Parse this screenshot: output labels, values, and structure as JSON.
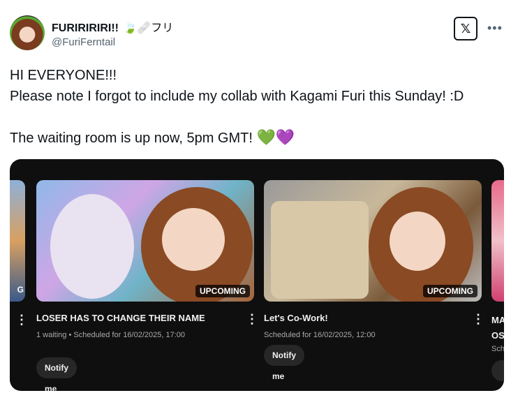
{
  "author": {
    "display_name": "FURIRIRIRI!!",
    "name_emoji": "🍃🩹フリ",
    "handle": "@FuriFerntail",
    "x_logo": "x-logo-icon",
    "more_icon": "more-icon"
  },
  "tweet": {
    "line1": "HI EVERYONE!!!",
    "line2": "Please note I forgot to include my collab with Kagami Furi this Sunday! :D",
    "line3": "The waiting room is up now, 5pm GMT!",
    "heart1": "💚",
    "heart2": "💜"
  },
  "videos": [
    {
      "badge": "UPCOMING",
      "title": "LOSER HAS TO CHANGE THEIR NAME",
      "meta": "1 waiting • Scheduled for 16/02/2025, 17:00",
      "button": "Notify me"
    },
    {
      "badge": "UPCOMING",
      "title": "Let's Co-Work!",
      "meta": "Scheduled for 16/02/2025, 12:00",
      "button": "Notify me"
    }
  ],
  "partial": {
    "left_badge": "G",
    "right_title_1": "MA",
    "right_title_2": "OS",
    "right_meta": "Sch"
  },
  "colors": {
    "card_bg": "#0f0f0f",
    "button_bg": "#272727",
    "handle_gray": "#536471"
  }
}
